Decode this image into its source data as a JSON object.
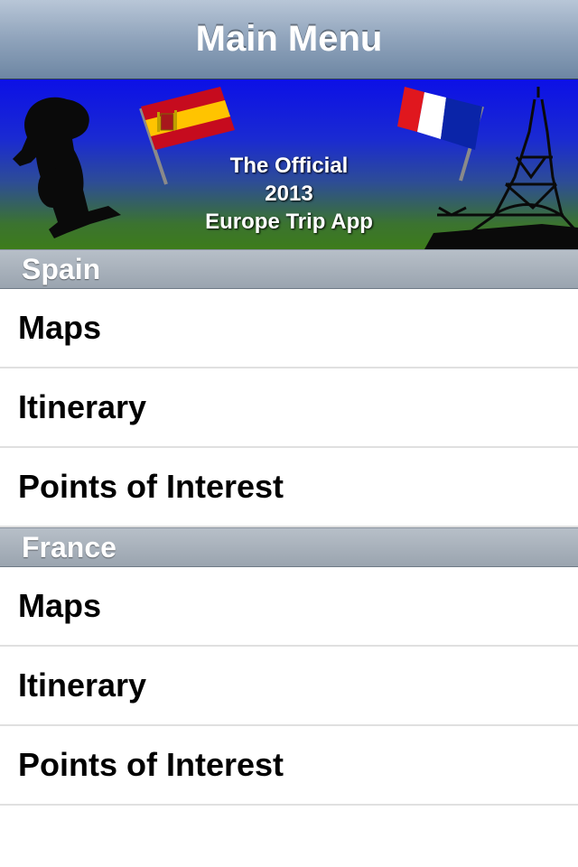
{
  "navbar": {
    "title": "Main Menu"
  },
  "banner": {
    "line1": "The Official",
    "line2": "2013",
    "line3": "Europe Trip App"
  },
  "sections": [
    {
      "header": "Spain",
      "items": [
        {
          "label": "Maps"
        },
        {
          "label": "Itinerary"
        },
        {
          "label": "Points of Interest"
        }
      ]
    },
    {
      "header": "France",
      "items": [
        {
          "label": "Maps"
        },
        {
          "label": "Itinerary"
        },
        {
          "label": "Points of Interest"
        }
      ]
    }
  ],
  "colors": {
    "banner_top": "#0c10e6",
    "banner_bottom": "#3d7c1a",
    "spain_red": "#c60b1e",
    "spain_yellow": "#ffc400",
    "france_blue": "#0a24a8",
    "france_red": "#e0171e"
  }
}
